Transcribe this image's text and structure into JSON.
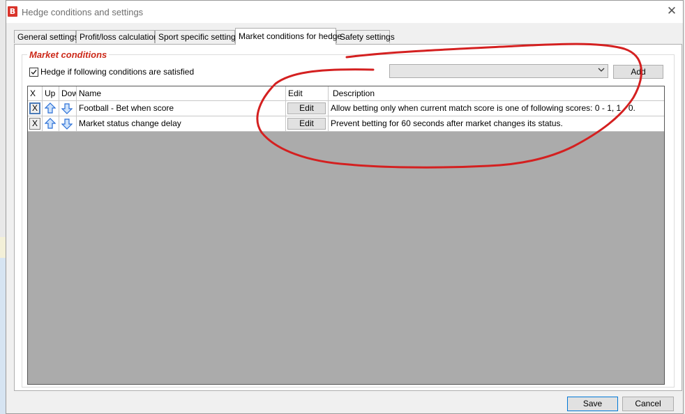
{
  "window": {
    "title": "Hedge conditions and settings",
    "app_icon_letter": "B",
    "close_glyph": "✕"
  },
  "tabs": [
    {
      "label": "General settings",
      "active": false
    },
    {
      "label": "Profit/loss calculation",
      "active": false
    },
    {
      "label": "Sport specific settings",
      "active": false
    },
    {
      "label": "Market conditions for hedge",
      "active": true
    },
    {
      "label": "Safety settings",
      "active": false
    }
  ],
  "market_conditions": {
    "group_title": "Market conditions",
    "checkbox_label": "Hedge if following conditions are satisfied",
    "checkbox_checked": true,
    "combo_value": "",
    "add_label": "Add"
  },
  "grid": {
    "headers": {
      "x": "X",
      "up": "Up",
      "down": "Down",
      "name": "Name",
      "edit": "Edit",
      "description": "Description"
    },
    "rows": [
      {
        "x_label": "X",
        "name": "Football - Bet when score",
        "edit_label": "Edit",
        "description": "Allow betting only when current match score is one of following scores: 0 - 1, 1 - 0."
      },
      {
        "x_label": "X",
        "name": "Market status change delay",
        "edit_label": "Edit",
        "description": "Prevent betting for 60 seconds after market changes its status."
      }
    ]
  },
  "footer": {
    "save_label": "Save",
    "cancel_label": "Cancel"
  },
  "icons": {
    "up": "arrow-up-icon",
    "down": "arrow-down-icon",
    "checkmark": "checkmark-icon"
  },
  "colors": {
    "group_title": "#cc2a1a",
    "annotation": "#d42020",
    "arrow": "#2a6fd6",
    "grid_empty": "#ababab"
  }
}
